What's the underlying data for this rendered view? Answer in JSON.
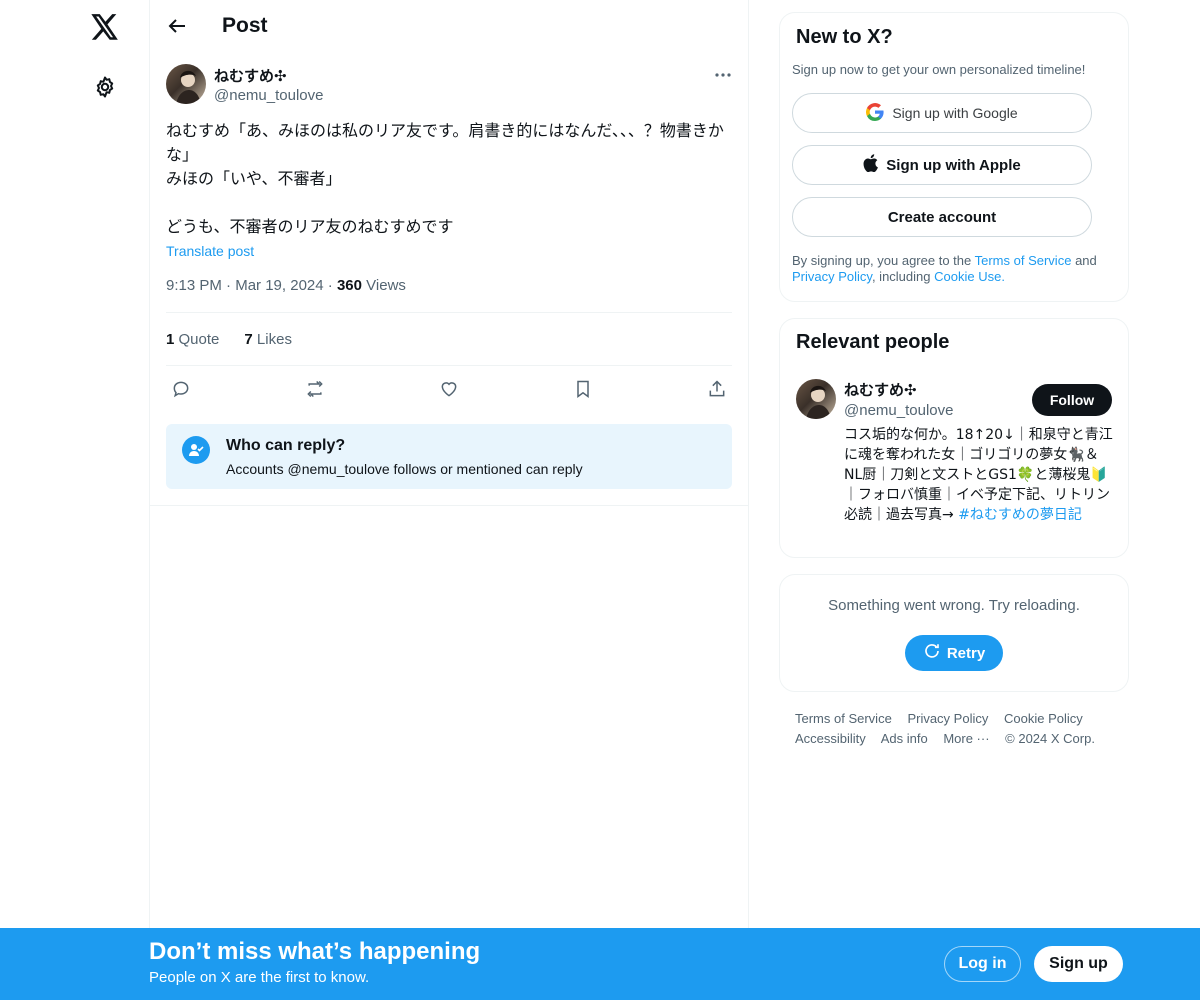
{
  "nav": {
    "logo_icon": "x-logo-icon",
    "settings_icon": "gear-icon"
  },
  "header": {
    "title": "Post"
  },
  "post": {
    "author_name": "ねむすめ✣",
    "author_handle": "@nemu_toulove",
    "text": "ねむすめ「あ、みほのは私のリア友です。肩書き的にはなんだ、、、？物書きかな」\nみほの「いや、不審者」\n\nどうも、不審者のリア友のねむすめです",
    "translate_label": "Translate post",
    "time": "9:13 PM",
    "date": "Mar 19, 2024",
    "views_count": "360",
    "views_label": "Views",
    "quotes_count": "1",
    "quotes_label": "Quote",
    "likes_count": "7",
    "likes_label": "Likes"
  },
  "reply_restriction": {
    "title": "Who can reply?",
    "subtitle": "Accounts @nemu_toulove follows or mentioned can reply"
  },
  "signup_card": {
    "title": "New to X?",
    "subtitle": "Sign up now to get your own personalized timeline!",
    "google_label": "Sign up with Google",
    "apple_label": "Sign up with Apple",
    "create_label": "Create account",
    "legal_prefix": "By signing up, you agree to the",
    "terms_link": "Terms of Service",
    "and_word": "and",
    "privacy_link": "Privacy Policy",
    "including_word": ", including",
    "cookie_link": "Cookie Use."
  },
  "relevant_people": {
    "title": "Relevant people",
    "name": "ねむすめ✣",
    "handle": "@nemu_toulove",
    "follow_label": "Follow",
    "bio": "コス垢的な何か。18↑20↓｜和泉守と青江に魂を奪われた女｜ゴリゴリの夢女🐈‍⬛＆NL厨｜刀剣と文ストとGS1🍀と薄桜鬼🔰｜フォロバ慎重｜イベ予定下記、リトリン必読｜過去写真→ ",
    "bio_tag": "#ねむすめの夢日記"
  },
  "error_card": {
    "message": "Something went wrong. Try reloading.",
    "retry_label": "Retry"
  },
  "footer": {
    "links": [
      "Terms of Service",
      "Privacy Policy",
      "Cookie Policy",
      "Accessibility",
      "Ads info",
      "More ···",
      "© 2024 X Corp."
    ]
  },
  "bottom_bar": {
    "title": "Don’t miss what’s happening",
    "subtitle": "People on X are the first to know.",
    "login_label": "Log in",
    "signup_label": "Sign up"
  },
  "colors": {
    "accent": "#1d9bf0",
    "text": "#0f1419",
    "muted": "#536471"
  }
}
